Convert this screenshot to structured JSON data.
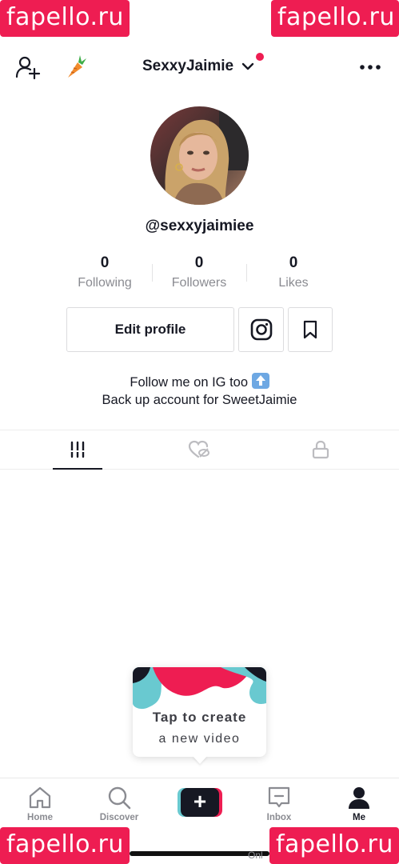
{
  "watermark": {
    "text": "fapello.ru"
  },
  "header": {
    "username": "SexxyJaimie"
  },
  "profile": {
    "handle": "@sexxyjaimiee"
  },
  "stats": [
    {
      "value": "0",
      "label": "Following"
    },
    {
      "value": "0",
      "label": "Followers"
    },
    {
      "value": "0",
      "label": "Likes"
    }
  ],
  "actions": {
    "edit_label": "Edit profile"
  },
  "bio": {
    "line1": "Follow me on IG too",
    "line2": "Back up account for SweetJaimie"
  },
  "tooltip": {
    "line1": "Tap to create",
    "line2": "a new video"
  },
  "nav": [
    {
      "label": "Home",
      "icon": "home-icon"
    },
    {
      "label": "Discover",
      "icon": "search-icon"
    },
    {
      "label": "+",
      "icon": "plus-icon"
    },
    {
      "label": "Inbox",
      "icon": "inbox-icon"
    },
    {
      "label": "Me",
      "icon": "person-icon"
    }
  ],
  "footer": {
    "partial_text": "Onl"
  },
  "colors": {
    "accent": "#ee1d52",
    "cyan": "#69c9d0",
    "text": "#161823",
    "muted": "#8a8b91"
  }
}
